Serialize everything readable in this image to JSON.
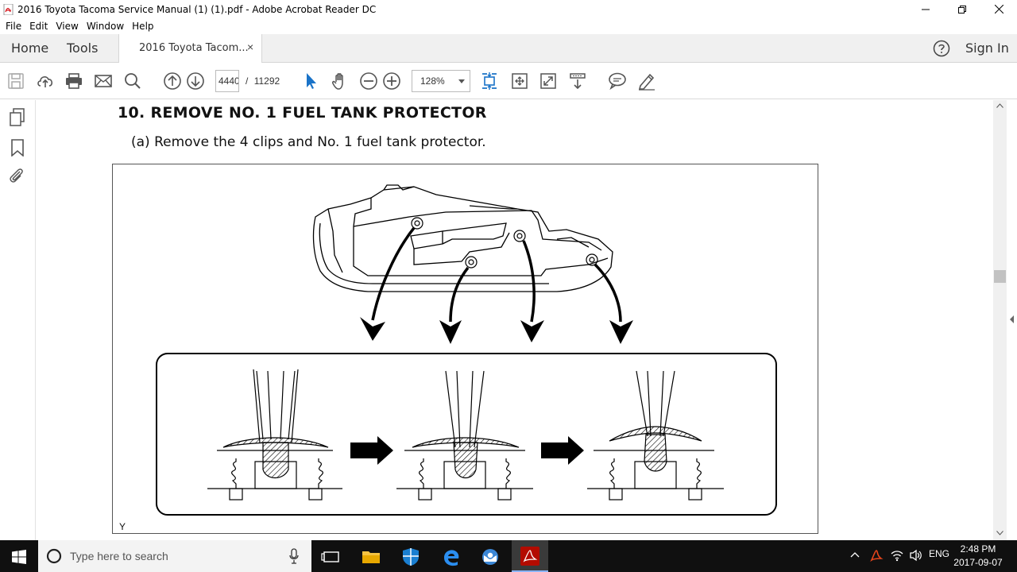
{
  "window": {
    "title": "2016 Toyota Tacoma Service Manual (1) (1).pdf - Adobe Acrobat Reader DC"
  },
  "menu": [
    "File",
    "Edit",
    "View",
    "Window",
    "Help"
  ],
  "tabs": {
    "home": "Home",
    "tools": "Tools",
    "document": "2016 Toyota Tacom...",
    "close_glyph": "×",
    "sign_in": "Sign In"
  },
  "toolbar": {
    "page_current": "4440",
    "page_separator": "/",
    "page_total": "11292",
    "zoom": "128%"
  },
  "document": {
    "heading": "10. REMOVE NO. 1 FUEL TANK PROTECTOR",
    "step": "(a) Remove the 4 clips and No. 1 fuel tank protector.",
    "figure_code": "Y"
  },
  "taskbar": {
    "search_placeholder": "Type here to search",
    "language": "ENG",
    "time": "2:48 PM",
    "date": "2017-09-07"
  }
}
